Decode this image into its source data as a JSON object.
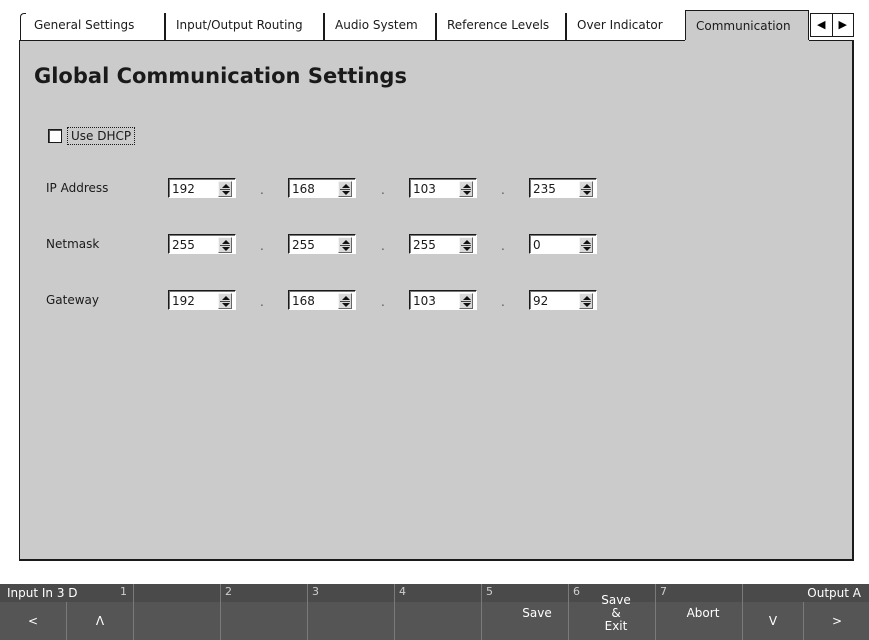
{
  "tabs": [
    {
      "label": "General Settings",
      "active": false
    },
    {
      "label": "Input/Output Routing",
      "active": false
    },
    {
      "label": "Audio System",
      "active": false
    },
    {
      "label": "Reference Levels",
      "active": false
    },
    {
      "label": "Over Indicator",
      "active": false
    },
    {
      "label": "Communication",
      "active": true
    }
  ],
  "tab_scroll": {
    "left_icon": "triangle-left-icon",
    "right_icon": "triangle-right-icon",
    "left_glyph": "◀",
    "right_glyph": "▶"
  },
  "page": {
    "title": "Global Communication Settings"
  },
  "dhcp": {
    "label": "Use DHCP",
    "checked": false
  },
  "fields": {
    "ip": {
      "label": "IP Address",
      "octets": [
        "192",
        "168",
        "103",
        "235"
      ]
    },
    "netmask": {
      "label": "Netmask",
      "octets": [
        "255",
        "255",
        "255",
        "0"
      ]
    },
    "gateway": {
      "label": "Gateway",
      "octets": [
        "192",
        "168",
        "103",
        "92"
      ]
    },
    "separator": "."
  },
  "softkeys": {
    "left_title": "Input In 3 D",
    "right_title": "Output A",
    "nav": {
      "left": "<",
      "up": "Λ",
      "down": "V",
      "right": ">"
    },
    "keys": [
      {
        "num": "1",
        "label": ""
      },
      {
        "num": "2",
        "label": ""
      },
      {
        "num": "3",
        "label": ""
      },
      {
        "num": "4",
        "label": ""
      },
      {
        "num": "5",
        "label": "Save"
      },
      {
        "num": "6",
        "label_lines": [
          "Save",
          "&",
          "Exit"
        ]
      },
      {
        "num": "7",
        "label": "Abort"
      }
    ]
  },
  "colors": {
    "panel": "#cbcbcb",
    "softbar": "#555555",
    "text": "#1a1a1a"
  }
}
